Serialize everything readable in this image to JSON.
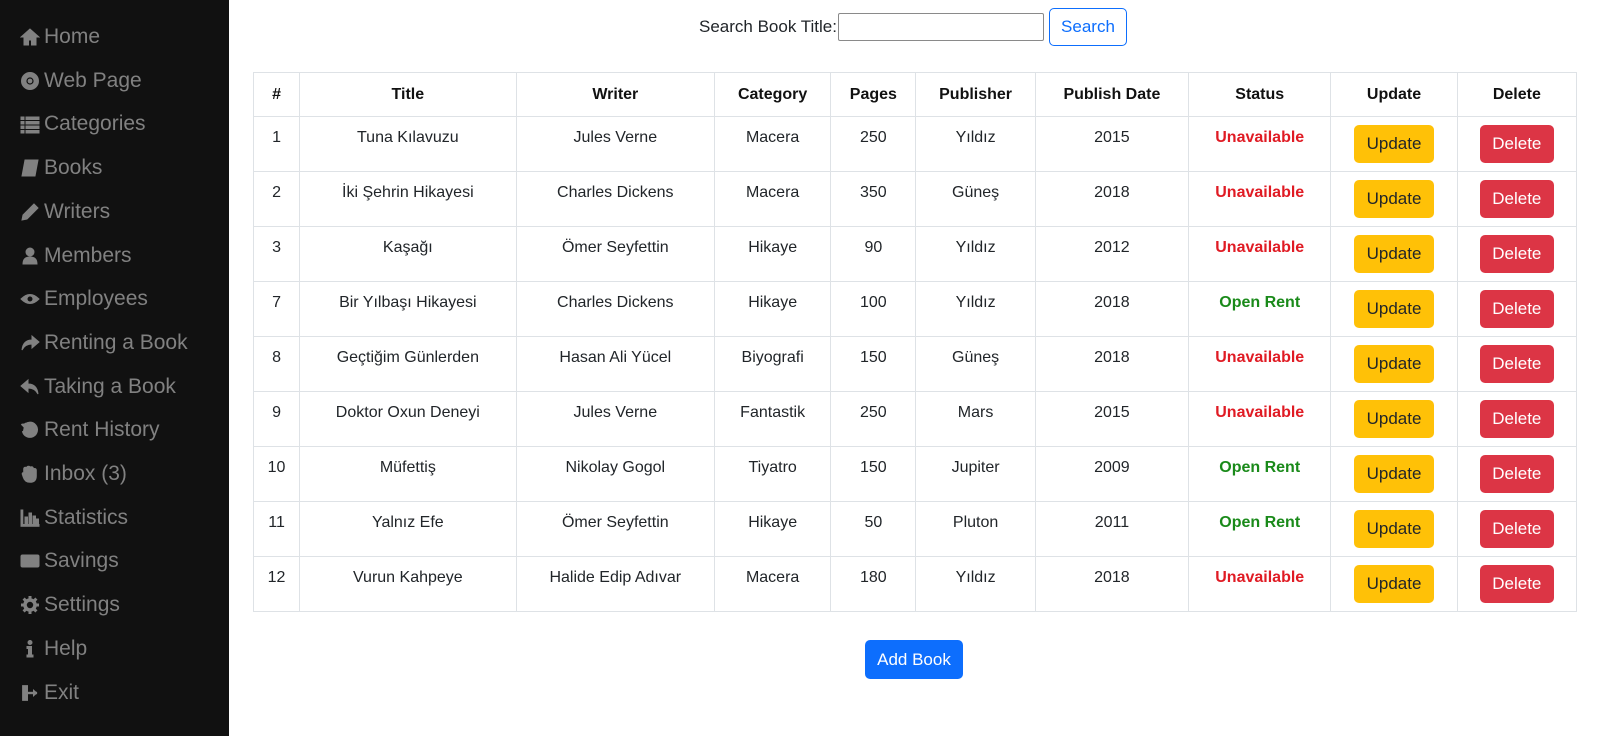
{
  "sidebar": {
    "items": [
      {
        "label": "Home",
        "icon": "home-icon"
      },
      {
        "label": "Web Page",
        "icon": "chrome-icon"
      },
      {
        "label": "Categories",
        "icon": "list-icon"
      },
      {
        "label": "Books",
        "icon": "book-icon"
      },
      {
        "label": "Writers",
        "icon": "pencil-icon"
      },
      {
        "label": "Members",
        "icon": "user-icon"
      },
      {
        "label": "Employees",
        "icon": "eye-icon"
      },
      {
        "label": "Renting a Book",
        "icon": "share-icon"
      },
      {
        "label": "Taking a Book",
        "icon": "reply-icon"
      },
      {
        "label": "Rent History",
        "icon": "history-icon"
      },
      {
        "label": "Inbox (3)",
        "icon": "hand-icon"
      },
      {
        "label": "Statistics",
        "icon": "bar-chart-icon"
      },
      {
        "label": "Savings",
        "icon": "money-icon"
      },
      {
        "label": "Settings",
        "icon": "gear-icon"
      },
      {
        "label": "Help",
        "icon": "info-icon"
      },
      {
        "label": "Exit",
        "icon": "sign-out-icon"
      }
    ]
  },
  "search": {
    "label": "Search Book Title:",
    "value": "",
    "placeholder": "",
    "button_label": "Search"
  },
  "table": {
    "headers": [
      "#",
      "Title",
      "Writer",
      "Category",
      "Pages",
      "Publisher",
      "Publish Date",
      "Status",
      "Update",
      "Delete"
    ],
    "update_label": "Update",
    "delete_label": "Delete",
    "rows": [
      {
        "id": "1",
        "title": "Tuna Kılavuzu",
        "writer": "Jules Verne",
        "category": "Macera",
        "pages": "250",
        "publisher": "Yıldız",
        "date": "2015",
        "status": "Unavailable"
      },
      {
        "id": "2",
        "title": "İki Şehrin Hikayesi",
        "writer": "Charles Dickens",
        "category": "Macera",
        "pages": "350",
        "publisher": "Güneş",
        "date": "2018",
        "status": "Unavailable"
      },
      {
        "id": "3",
        "title": "Kaşağı",
        "writer": "Ömer Seyfettin",
        "category": "Hikaye",
        "pages": "90",
        "publisher": "Yıldız",
        "date": "2012",
        "status": "Unavailable"
      },
      {
        "id": "7",
        "title": "Bir Yılbaşı Hikayesi",
        "writer": "Charles Dickens",
        "category": "Hikaye",
        "pages": "100",
        "publisher": "Yıldız",
        "date": "2018",
        "status": "Open Rent"
      },
      {
        "id": "8",
        "title": "Geçtiğim Günlerden",
        "writer": "Hasan Ali Yücel",
        "category": "Biyografi",
        "pages": "150",
        "publisher": "Güneş",
        "date": "2018",
        "status": "Unavailable"
      },
      {
        "id": "9",
        "title": "Doktor Oxun Deneyi",
        "writer": "Jules Verne",
        "category": "Fantastik",
        "pages": "250",
        "publisher": "Mars",
        "date": "2015",
        "status": "Unavailable"
      },
      {
        "id": "10",
        "title": "Müfettiş",
        "writer": "Nikolay Gogol",
        "category": "Tiyatro",
        "pages": "150",
        "publisher": "Jupiter",
        "date": "2009",
        "status": "Open Rent"
      },
      {
        "id": "11",
        "title": "Yalnız Efe",
        "writer": "Ömer Seyfettin",
        "category": "Hikaye",
        "pages": "50",
        "publisher": "Pluton",
        "date": "2011",
        "status": "Open Rent"
      },
      {
        "id": "12",
        "title": "Vurun Kahpeye",
        "writer": "Halide Edip Adıvar",
        "category": "Macera",
        "pages": "180",
        "publisher": "Yıldız",
        "date": "2018",
        "status": "Unavailable"
      }
    ]
  },
  "add_book_label": "Add Book",
  "colors": {
    "sidebar_bg": "#111111",
    "sidebar_text": "#818181",
    "unavailable": "#e01b24",
    "open_rent": "#1a8a1a",
    "update_button": "#ffc107",
    "delete_button": "#dc3545",
    "primary": "#0d6efd"
  }
}
